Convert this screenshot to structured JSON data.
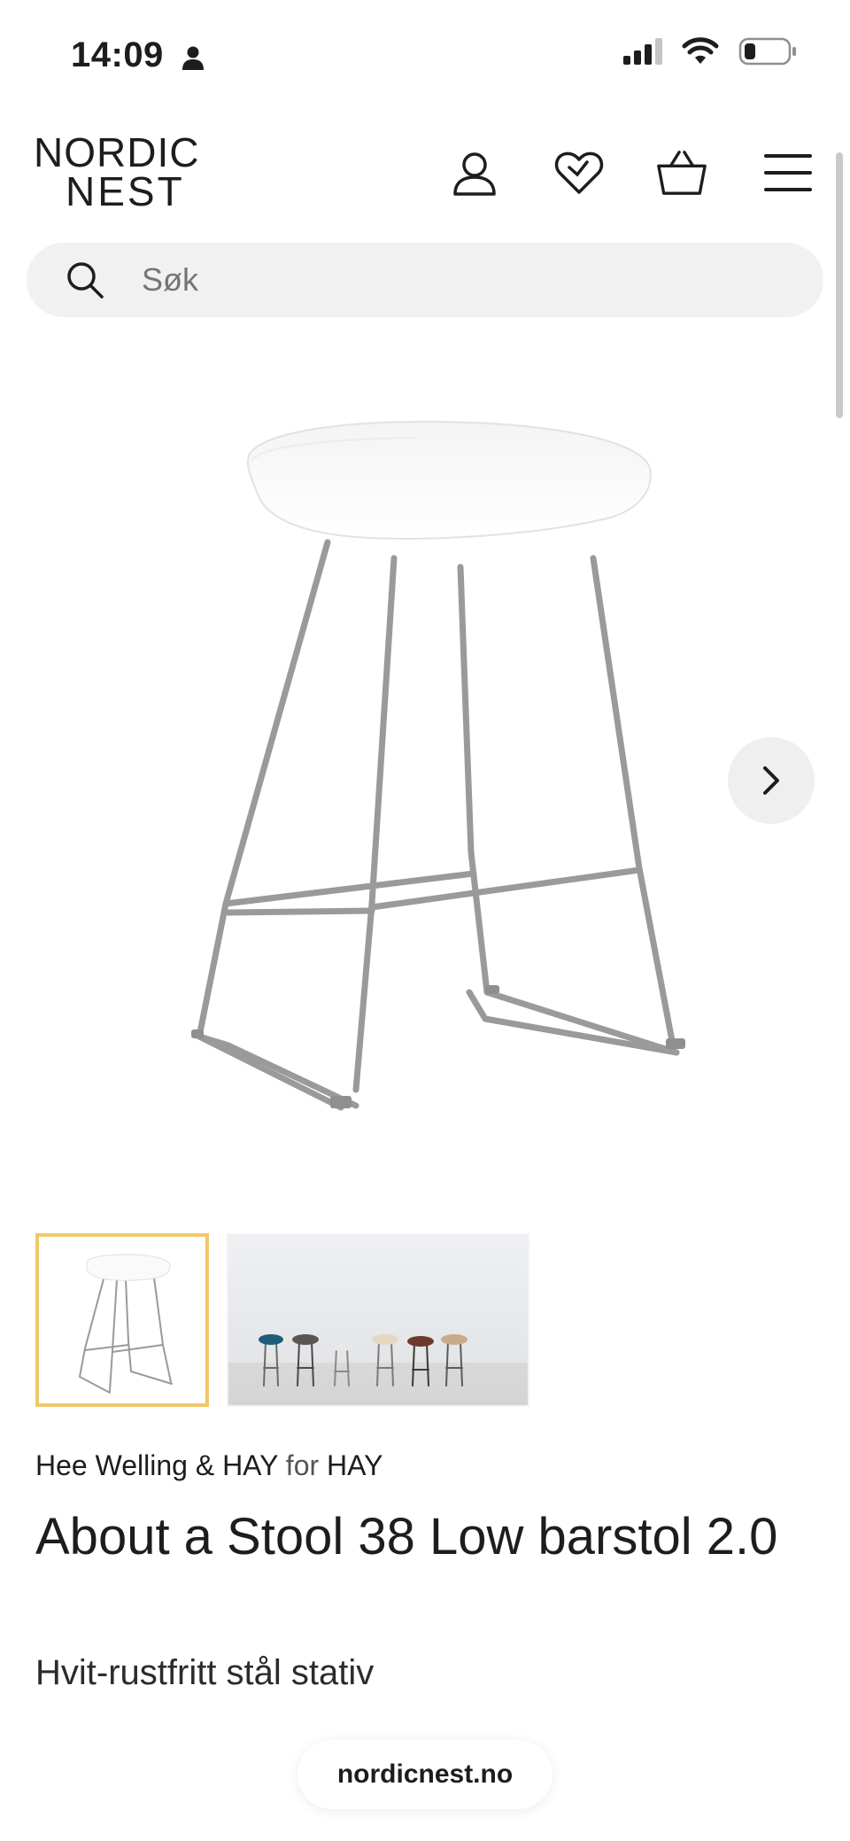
{
  "status_bar": {
    "time": "14:09",
    "person_icon": "person-icon",
    "signal_icon": "cellular-signal-icon",
    "wifi_icon": "wifi-icon",
    "battery_icon": "battery-icon",
    "battery_level": 0.25
  },
  "header": {
    "logo_line1": "NORDIC",
    "logo_line2": "NEST",
    "icons": [
      "account-icon",
      "wishlist-heart-icon",
      "basket-icon",
      "menu-icon"
    ]
  },
  "search": {
    "placeholder": "Søk",
    "icon": "search-icon"
  },
  "gallery": {
    "next_icon": "chevron-right-icon",
    "selected_thumbnail": 1,
    "thumbnail_count": 2
  },
  "product": {
    "designer": "Hee Welling & HAY",
    "for_word": "for",
    "brand": "HAY",
    "title": "About a Stool 38 Low barstol 2.0",
    "variant": "Hvit-rustfritt stål stativ"
  },
  "browser": {
    "domain": "nordicnest.no"
  },
  "colors": {
    "accent_thumbnail_border": "#f0c86a",
    "search_background": "#f1f1f1",
    "text": "#1d1d1f"
  }
}
